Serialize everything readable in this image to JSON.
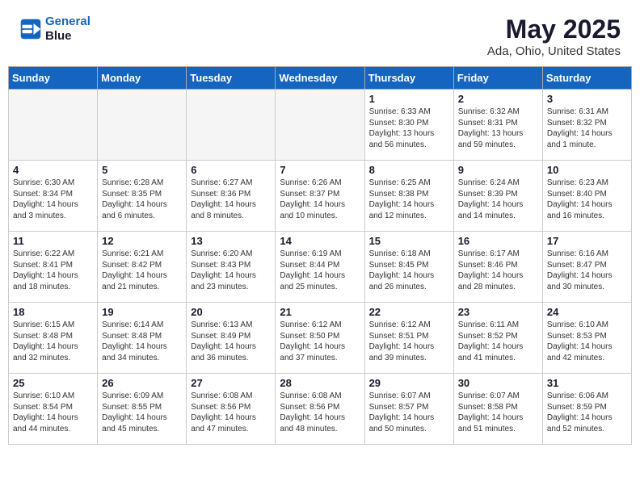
{
  "header": {
    "logo_line1": "General",
    "logo_line2": "Blue",
    "month": "May 2025",
    "location": "Ada, Ohio, United States"
  },
  "weekdays": [
    "Sunday",
    "Monday",
    "Tuesday",
    "Wednesday",
    "Thursday",
    "Friday",
    "Saturday"
  ],
  "weeks": [
    [
      {
        "day": "",
        "info": ""
      },
      {
        "day": "",
        "info": ""
      },
      {
        "day": "",
        "info": ""
      },
      {
        "day": "",
        "info": ""
      },
      {
        "day": "1",
        "info": "Sunrise: 6:33 AM\nSunset: 8:30 PM\nDaylight: 13 hours\nand 56 minutes."
      },
      {
        "day": "2",
        "info": "Sunrise: 6:32 AM\nSunset: 8:31 PM\nDaylight: 13 hours\nand 59 minutes."
      },
      {
        "day": "3",
        "info": "Sunrise: 6:31 AM\nSunset: 8:32 PM\nDaylight: 14 hours\nand 1 minute."
      }
    ],
    [
      {
        "day": "4",
        "info": "Sunrise: 6:30 AM\nSunset: 8:34 PM\nDaylight: 14 hours\nand 3 minutes."
      },
      {
        "day": "5",
        "info": "Sunrise: 6:28 AM\nSunset: 8:35 PM\nDaylight: 14 hours\nand 6 minutes."
      },
      {
        "day": "6",
        "info": "Sunrise: 6:27 AM\nSunset: 8:36 PM\nDaylight: 14 hours\nand 8 minutes."
      },
      {
        "day": "7",
        "info": "Sunrise: 6:26 AM\nSunset: 8:37 PM\nDaylight: 14 hours\nand 10 minutes."
      },
      {
        "day": "8",
        "info": "Sunrise: 6:25 AM\nSunset: 8:38 PM\nDaylight: 14 hours\nand 12 minutes."
      },
      {
        "day": "9",
        "info": "Sunrise: 6:24 AM\nSunset: 8:39 PM\nDaylight: 14 hours\nand 14 minutes."
      },
      {
        "day": "10",
        "info": "Sunrise: 6:23 AM\nSunset: 8:40 PM\nDaylight: 14 hours\nand 16 minutes."
      }
    ],
    [
      {
        "day": "11",
        "info": "Sunrise: 6:22 AM\nSunset: 8:41 PM\nDaylight: 14 hours\nand 18 minutes."
      },
      {
        "day": "12",
        "info": "Sunrise: 6:21 AM\nSunset: 8:42 PM\nDaylight: 14 hours\nand 21 minutes."
      },
      {
        "day": "13",
        "info": "Sunrise: 6:20 AM\nSunset: 8:43 PM\nDaylight: 14 hours\nand 23 minutes."
      },
      {
        "day": "14",
        "info": "Sunrise: 6:19 AM\nSunset: 8:44 PM\nDaylight: 14 hours\nand 25 minutes."
      },
      {
        "day": "15",
        "info": "Sunrise: 6:18 AM\nSunset: 8:45 PM\nDaylight: 14 hours\nand 26 minutes."
      },
      {
        "day": "16",
        "info": "Sunrise: 6:17 AM\nSunset: 8:46 PM\nDaylight: 14 hours\nand 28 minutes."
      },
      {
        "day": "17",
        "info": "Sunrise: 6:16 AM\nSunset: 8:47 PM\nDaylight: 14 hours\nand 30 minutes."
      }
    ],
    [
      {
        "day": "18",
        "info": "Sunrise: 6:15 AM\nSunset: 8:48 PM\nDaylight: 14 hours\nand 32 minutes."
      },
      {
        "day": "19",
        "info": "Sunrise: 6:14 AM\nSunset: 8:48 PM\nDaylight: 14 hours\nand 34 minutes."
      },
      {
        "day": "20",
        "info": "Sunrise: 6:13 AM\nSunset: 8:49 PM\nDaylight: 14 hours\nand 36 minutes."
      },
      {
        "day": "21",
        "info": "Sunrise: 6:12 AM\nSunset: 8:50 PM\nDaylight: 14 hours\nand 37 minutes."
      },
      {
        "day": "22",
        "info": "Sunrise: 6:12 AM\nSunset: 8:51 PM\nDaylight: 14 hours\nand 39 minutes."
      },
      {
        "day": "23",
        "info": "Sunrise: 6:11 AM\nSunset: 8:52 PM\nDaylight: 14 hours\nand 41 minutes."
      },
      {
        "day": "24",
        "info": "Sunrise: 6:10 AM\nSunset: 8:53 PM\nDaylight: 14 hours\nand 42 minutes."
      }
    ],
    [
      {
        "day": "25",
        "info": "Sunrise: 6:10 AM\nSunset: 8:54 PM\nDaylight: 14 hours\nand 44 minutes."
      },
      {
        "day": "26",
        "info": "Sunrise: 6:09 AM\nSunset: 8:55 PM\nDaylight: 14 hours\nand 45 minutes."
      },
      {
        "day": "27",
        "info": "Sunrise: 6:08 AM\nSunset: 8:56 PM\nDaylight: 14 hours\nand 47 minutes."
      },
      {
        "day": "28",
        "info": "Sunrise: 6:08 AM\nSunset: 8:56 PM\nDaylight: 14 hours\nand 48 minutes."
      },
      {
        "day": "29",
        "info": "Sunrise: 6:07 AM\nSunset: 8:57 PM\nDaylight: 14 hours\nand 50 minutes."
      },
      {
        "day": "30",
        "info": "Sunrise: 6:07 AM\nSunset: 8:58 PM\nDaylight: 14 hours\nand 51 minutes."
      },
      {
        "day": "31",
        "info": "Sunrise: 6:06 AM\nSunset: 8:59 PM\nDaylight: 14 hours\nand 52 minutes."
      }
    ]
  ]
}
